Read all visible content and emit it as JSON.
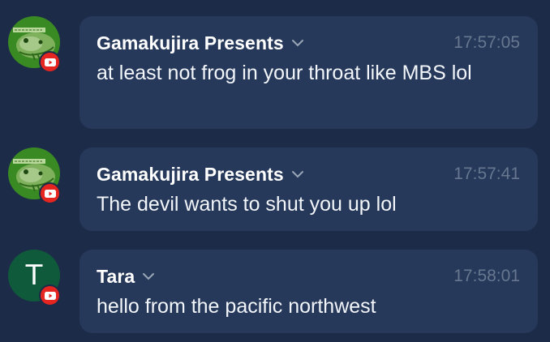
{
  "messages": [
    {
      "author": "Gamakujira Presents",
      "time": "17:57:05",
      "text": "at least not frog in your throat like MBS lol",
      "avatar_type": "image",
      "avatar_text": "Gamakujira Presents",
      "badge": "youtube-icon"
    },
    {
      "author": "Gamakujira Presents",
      "time": "17:57:41",
      "text": "The devil wants to shut you up lol",
      "avatar_type": "image",
      "avatar_text": "Gamakujira Presents",
      "badge": "youtube-icon"
    },
    {
      "author": "Tara",
      "time": "17:58:01",
      "text": "hello from the pacific northwest",
      "avatar_type": "letter",
      "avatar_letter": "T",
      "badge": "youtube-icon"
    }
  ],
  "colors": {
    "background": "#1c2b48",
    "bubble": "#26395a",
    "timestamp": "#66778f",
    "youtube": "#e52520",
    "avatar_tara": "#0f5a3b",
    "avatar_gamakujira": "#3a8a24"
  }
}
